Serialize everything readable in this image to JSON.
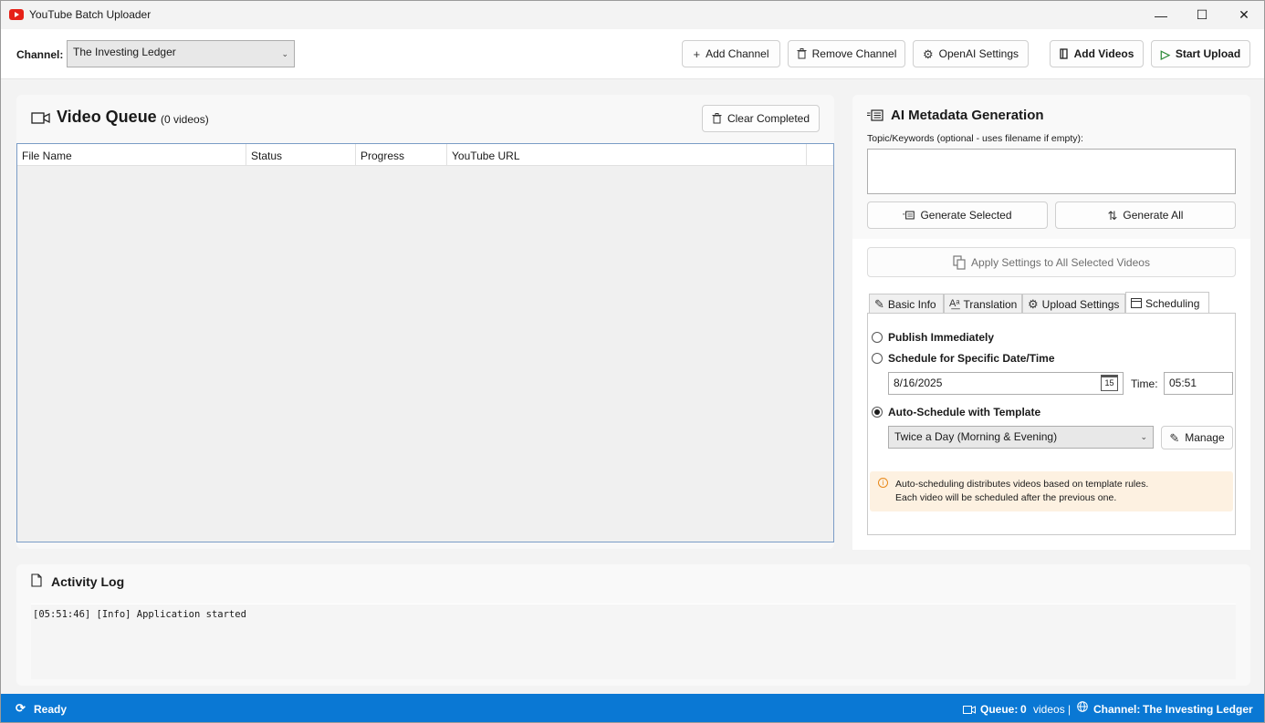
{
  "window": {
    "title": "YouTube Batch Uploader",
    "min": "—",
    "max": "☐",
    "close": "✕"
  },
  "toolbar": {
    "channel_label": "Channel:",
    "channel_value": "The Investing Ledger",
    "add_channel": "Add Channel",
    "remove_channel": "Remove Channel",
    "openai_settings": "OpenAI Settings",
    "add_videos": "Add Videos",
    "start_upload": "Start Upload"
  },
  "queue": {
    "title": "Video Queue",
    "count": "(0 videos)",
    "clear_completed": "Clear Completed",
    "columns": [
      "File Name",
      "Status",
      "Progress",
      "YouTube URL"
    ]
  },
  "ai": {
    "title": "AI Metadata Generation",
    "topic_label": "Topic/Keywords (optional - uses filename if empty):",
    "topic_value": "",
    "generate_selected": "Generate Selected",
    "generate_all": "Generate All",
    "apply_settings": "Apply Settings to All Selected Videos"
  },
  "tabs": [
    "Basic Info",
    "Translation",
    "Upload Settings",
    "Scheduling"
  ],
  "active_tab": "Scheduling",
  "scheduling": {
    "publish_immediately": "Publish Immediately",
    "schedule_specific": "Schedule for Specific Date/Time",
    "date_value": "8/16/2025",
    "calendar_day": "15",
    "time_label": "Time:",
    "time_value": "05:51",
    "auto_schedule": "Auto-Schedule with Template",
    "selected_option": "auto_schedule",
    "template_value": "Twice a Day (Morning & Evening)",
    "manage": "Manage",
    "info_line1": "Auto-scheduling distributes videos based on template rules.",
    "info_line2": "Each video will be scheduled after the previous one."
  },
  "log": {
    "title": "Activity Log",
    "lines": [
      "[05:51:46] [Info] Application started"
    ]
  },
  "status": {
    "state": "Ready",
    "queue_label": "Queue:",
    "queue_count": "0",
    "queue_unit": "videos |",
    "channel_label": "Channel:",
    "channel_value": "The Investing Ledger"
  },
  "colors": {
    "accent": "#0a78d4",
    "info_bg": "#fdf1e1",
    "info_icon": "#e8891b",
    "logo": "#e62117"
  }
}
